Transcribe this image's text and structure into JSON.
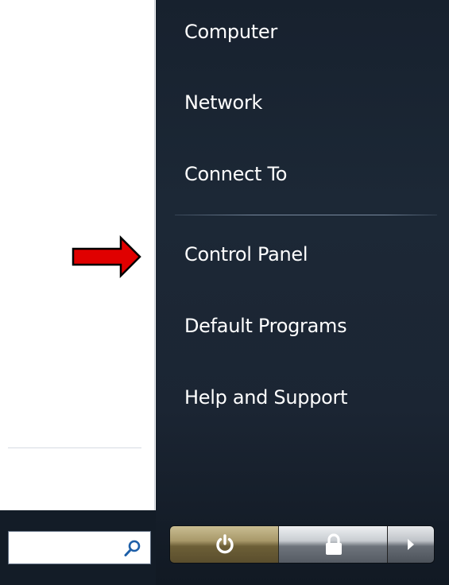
{
  "start_menu": {
    "right_items": [
      {
        "label": "Computer"
      },
      {
        "label": "Network"
      },
      {
        "label": "Connect To"
      },
      {
        "label": "Control Panel"
      },
      {
        "label": "Default Programs"
      },
      {
        "label": "Help and Support"
      }
    ],
    "search": {
      "placeholder": "",
      "value": "",
      "icon": "search-icon"
    },
    "buttons": {
      "power": "power-icon",
      "lock": "lock-icon",
      "more": "arrow-right-icon"
    }
  },
  "annotation": {
    "icon": "red-arrow",
    "color": "#e00000",
    "points_to": "Control Panel"
  },
  "colors": {
    "panel_dark": "#1b2533",
    "text": "#ffffff"
  }
}
